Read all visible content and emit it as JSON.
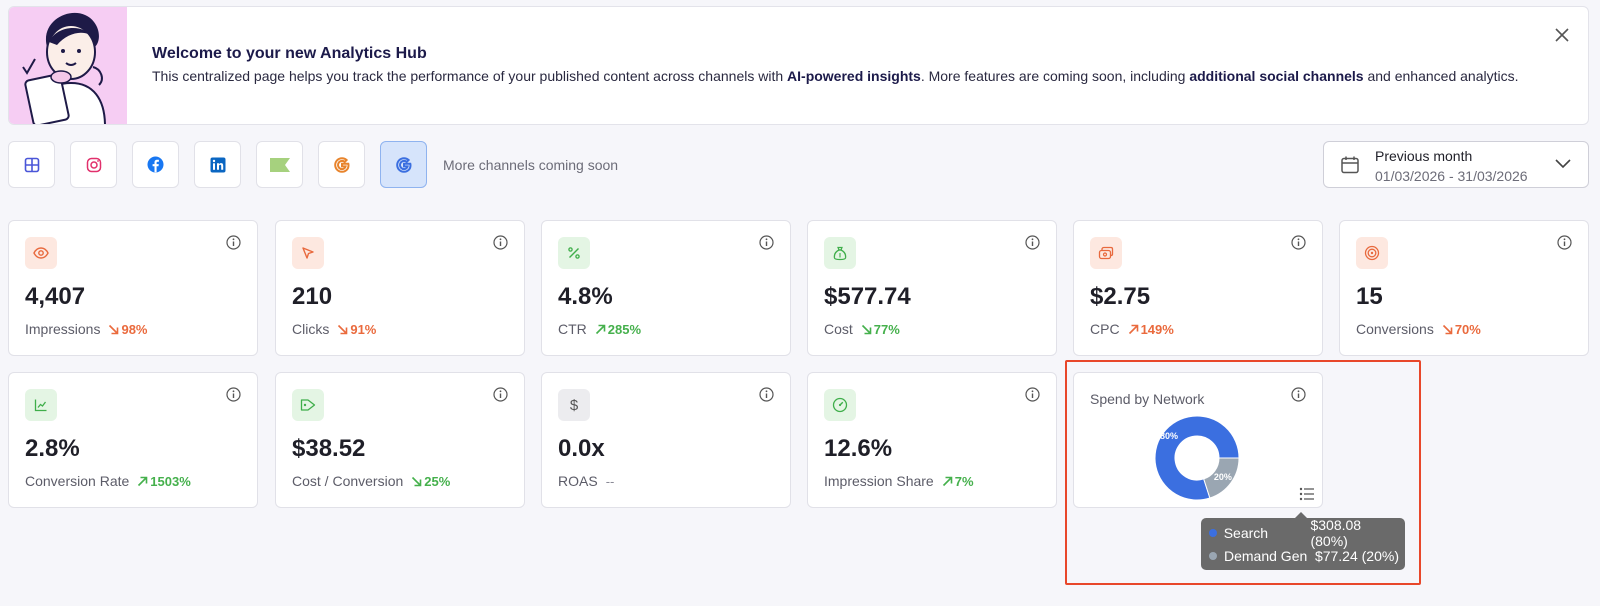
{
  "banner": {
    "title": "Welcome to your new Analytics Hub",
    "text_1": "This centralized page helps you track the performance of your published content across channels with ",
    "bold_1": "AI-powered insights",
    "text_2": ". More features are coming soon, including ",
    "bold_2": "additional social channels",
    "text_3": " and enhanced analytics."
  },
  "channels": {
    "items": [
      "all-channels",
      "instagram",
      "facebook",
      "linkedin",
      "flag",
      "google",
      "google-ads"
    ],
    "note": "More channels coming soon"
  },
  "date_filter": {
    "label": "Previous month",
    "range": "01/03/2026 - 31/03/2026"
  },
  "metrics": [
    {
      "value": "4,407",
      "label": "Impressions",
      "delta": "98%",
      "trend": "down"
    },
    {
      "value": "210",
      "label": "Clicks",
      "delta": "91%",
      "trend": "down"
    },
    {
      "value": "4.8%",
      "label": "CTR",
      "delta": "285%",
      "trend": "up"
    },
    {
      "value": "$577.74",
      "label": "Cost",
      "delta": "77%",
      "trend": "down"
    },
    {
      "value": "$2.75",
      "label": "CPC",
      "delta": "149%",
      "trend": "up"
    },
    {
      "value": "15",
      "label": "Conversions",
      "delta": "70%",
      "trend": "down"
    },
    {
      "value": "2.8%",
      "label": "Conversion Rate",
      "delta": "1503%",
      "trend": "up"
    },
    {
      "value": "$38.52",
      "label": "Cost / Conversion",
      "delta": "25%",
      "trend": "down"
    },
    {
      "value": "0.0x",
      "label": "ROAS",
      "delta": "--",
      "trend": "none"
    },
    {
      "value": "12.6%",
      "label": "Impression Share",
      "delta": "7%",
      "trend": "up"
    }
  ],
  "spend_card": {
    "title": "Spend by Network"
  },
  "chart_data": {
    "type": "pie",
    "title": "Spend by Network",
    "categories": [
      "Search",
      "Demand Gen"
    ],
    "values": [
      308.08,
      77.24
    ],
    "percent_labels": [
      "80%",
      "20%"
    ],
    "colors": [
      "#3b6fe0",
      "#9aa6b2"
    ]
  },
  "tooltip": {
    "rows": [
      {
        "name": "Search",
        "value": "$308.08 (80%)",
        "color": "#3b6fe0"
      },
      {
        "name": "Demand Gen",
        "value": "$77.24 (20%)",
        "color": "#9aa6b2"
      }
    ]
  }
}
